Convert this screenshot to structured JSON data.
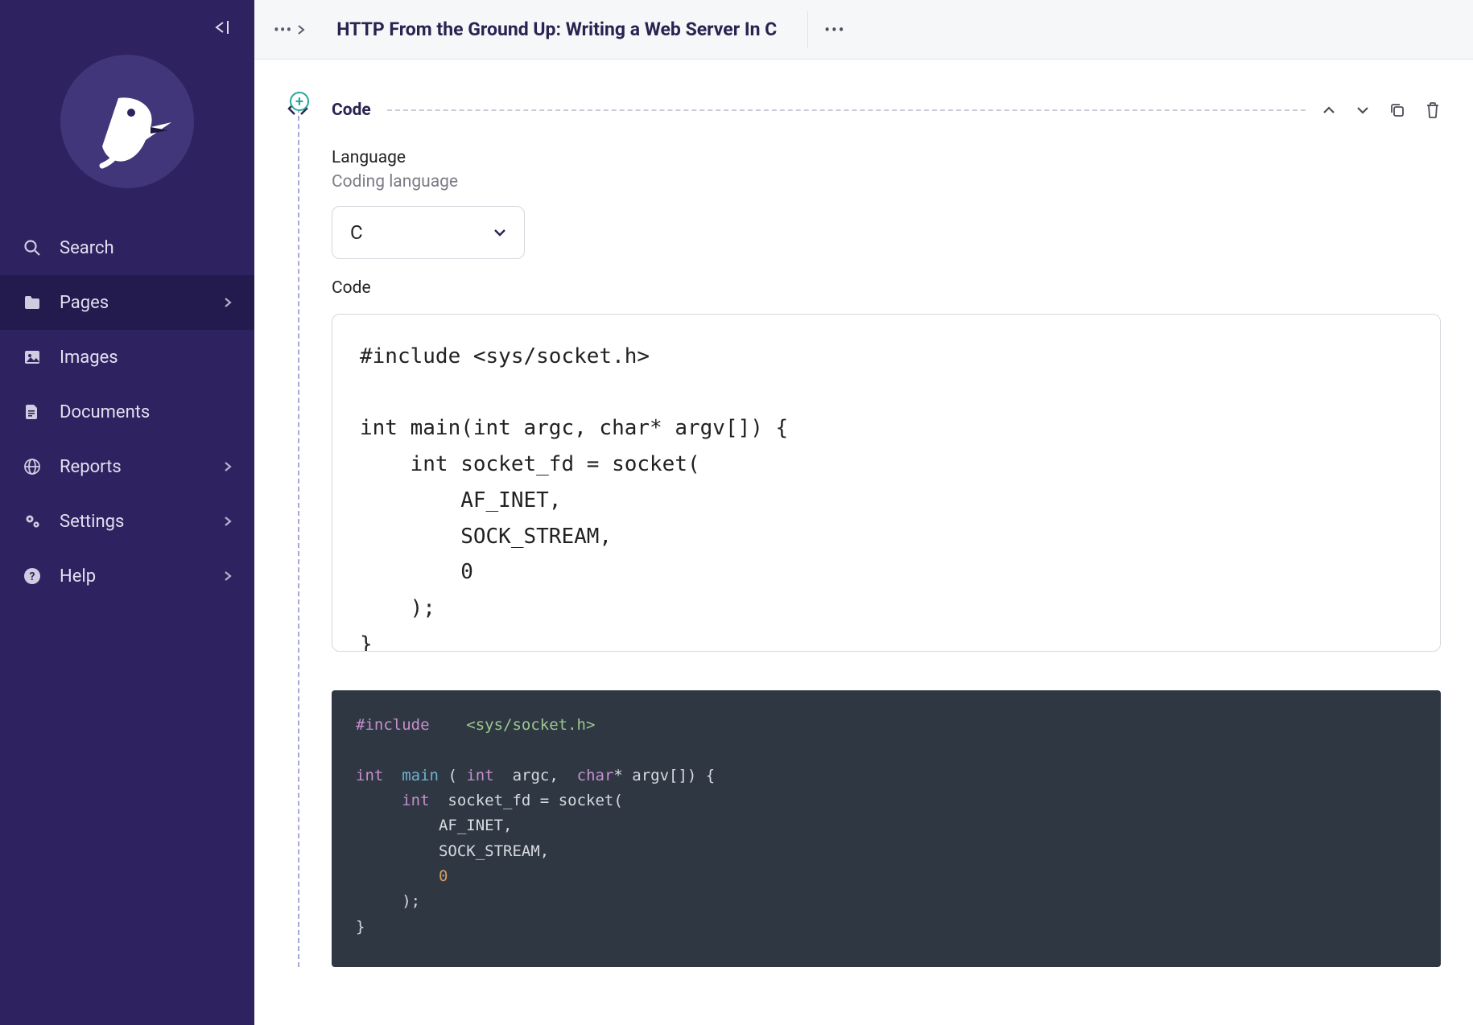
{
  "sidebar": {
    "items": [
      {
        "label": "Search",
        "icon": "search-icon",
        "chevron": false,
        "active": false
      },
      {
        "label": "Pages",
        "icon": "folder-icon",
        "chevron": true,
        "active": true
      },
      {
        "label": "Images",
        "icon": "image-icon",
        "chevron": false,
        "active": false
      },
      {
        "label": "Documents",
        "icon": "document-icon",
        "chevron": false,
        "active": false
      },
      {
        "label": "Reports",
        "icon": "globe-icon",
        "chevron": true,
        "active": false
      },
      {
        "label": "Settings",
        "icon": "gears-icon",
        "chevron": true,
        "active": false
      },
      {
        "label": "Help",
        "icon": "help-icon",
        "chevron": true,
        "active": false
      }
    ]
  },
  "topbar": {
    "page_title": "HTTP From the Ground Up: Writing a Web Server In C"
  },
  "block": {
    "type_label": "Code",
    "language_field": {
      "label": "Language",
      "sublabel": "Coding language",
      "value": "C"
    },
    "code_field": {
      "label": "Code",
      "value": "#include <sys/socket.h>\n\nint main(int argc, char* argv[]) {\n    int socket_fd = socket(\n        AF_INET,\n        SOCK_STREAM,\n        0\n    );\n}"
    },
    "preview_tokens": [
      [
        [
          "pre",
          "#include"
        ],
        [
          "",
          "  "
        ],
        [
          "str",
          "<sys/socket.h>"
        ]
      ],
      [],
      [
        [
          "type",
          "int"
        ],
        [
          "",
          ""
        ],
        [
          "fn",
          "main"
        ],
        [
          "id",
          "("
        ],
        [
          "type",
          "int"
        ],
        [
          "",
          ""
        ],
        [
          "id",
          "argc, "
        ],
        [
          "type",
          "char"
        ],
        [
          "id",
          "* argv[]) {"
        ]
      ],
      [
        [
          "",
          "    "
        ],
        [
          "type",
          "int"
        ],
        [
          "",
          ""
        ],
        [
          "id",
          "socket_fd = socket("
        ]
      ],
      [
        [
          "",
          "        "
        ],
        [
          "id",
          "AF_INET,"
        ]
      ],
      [
        [
          "",
          "        "
        ],
        [
          "id",
          "SOCK_STREAM,"
        ]
      ],
      [
        [
          "",
          "        "
        ],
        [
          "num",
          "0"
        ]
      ],
      [
        [
          "",
          "    "
        ],
        [
          "id",
          ");"
        ]
      ],
      [
        [
          "id",
          "}"
        ]
      ]
    ]
  }
}
